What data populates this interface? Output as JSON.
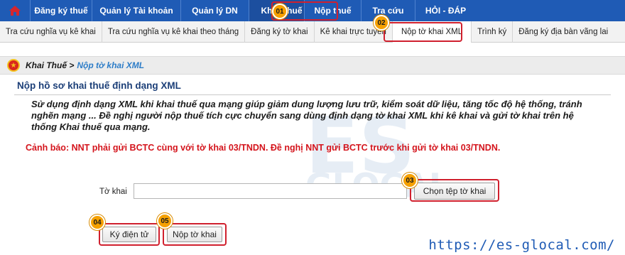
{
  "top_nav": {
    "items": [
      "Đăng ký thuế",
      "Quản lý Tài khoản",
      "Quản lý DN",
      "Khai Thuế",
      "Nộp thuế",
      "Tra cứu",
      "HỎI - ĐÁP"
    ]
  },
  "sub_nav": {
    "items": [
      "Tra cứu nghĩa vụ kê khai",
      "Tra cứu nghĩa vụ kê khai theo tháng",
      "Đăng ký tờ khai",
      "Kê khai trực tuyến",
      "Nộp tờ khai XML",
      "Trình ký",
      "Đăng ký địa bàn vãng lai"
    ]
  },
  "badges": [
    "01",
    "02",
    "03",
    "04",
    "05"
  ],
  "breadcrumb": {
    "parent": "Khai Thuế >",
    "current": "Nộp tờ khai XML"
  },
  "section": {
    "title": "Nộp hồ sơ khai thuế định dạng XML",
    "description": "Sử dụng định dạng XML khi khai thuế qua mạng giúp giảm dung lượng lưu trữ, kiểm soát dữ liệu, tăng tốc độ hệ thống, tránh nghẽn mạng ... Đề nghị người nộp thuế tích cực chuyển sang dùng định dạng tờ khai XML khi kê khai và gửi tờ khai trên hệ thống Khai thuế qua mạng.",
    "warning": "Cảnh báo: NNT phải gửi BCTC cùng với tờ khai 03/TNDN. Đề nghị NNT gửi BCTC trước khi gửi tờ khai 03/TNDN."
  },
  "form": {
    "label": "Tờ khai",
    "value": "",
    "choose_file": "Chọn tệp tờ khai",
    "sign": "Ký điện tử",
    "submit": "Nộp tờ khai"
  },
  "watermark": {
    "line1": "ES",
    "line2": "GLOCAL"
  },
  "footer_url": "https://es-glocal.com/",
  "colors": {
    "nav_blue": "#1f5bb5",
    "highlight_red": "#d0202e",
    "badge_orange": "#f5a000",
    "warning_red": "#d4141c"
  }
}
